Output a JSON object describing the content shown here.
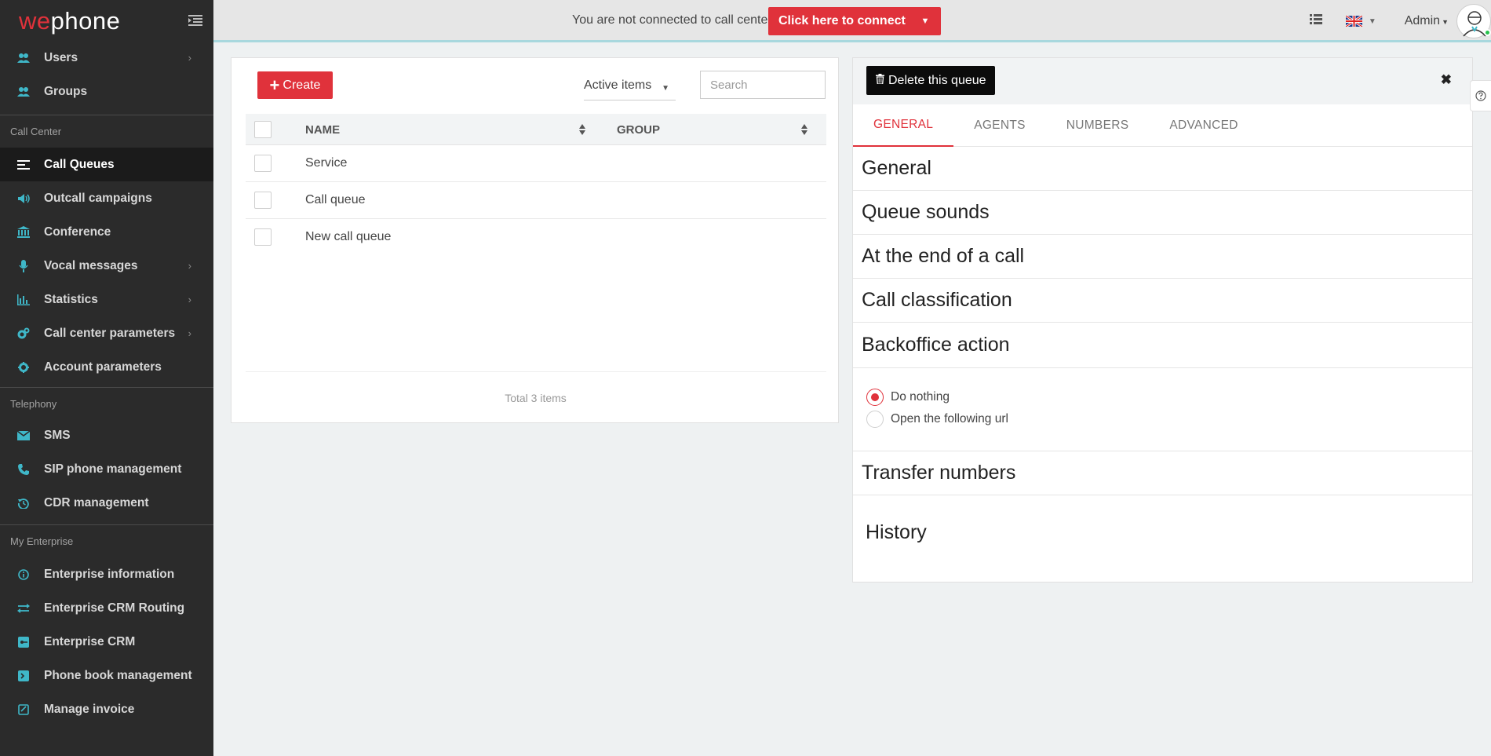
{
  "brand": {
    "logo_we": "we",
    "logo_phone": "phone"
  },
  "sidebar": {
    "items_top": [
      {
        "label": "Users",
        "icon": "users-icon",
        "chevron": true
      },
      {
        "label": "Groups",
        "icon": "groups-icon",
        "chevron": false
      }
    ],
    "section_call_center": "Call Center",
    "items_call_center": [
      {
        "label": "Call Queues",
        "icon": "queue-list-icon",
        "active": true
      },
      {
        "label": "Outcall campaigns",
        "icon": "megaphone-icon"
      },
      {
        "label": "Conference",
        "icon": "bank-icon"
      },
      {
        "label": "Vocal messages",
        "icon": "microphone-icon",
        "chevron": true
      },
      {
        "label": "Statistics",
        "icon": "bar-chart-icon",
        "chevron": true
      },
      {
        "label": "Call center parameters",
        "icon": "cogs-icon",
        "chevron": true
      },
      {
        "label": "Account parameters",
        "icon": "gear-icon"
      }
    ],
    "section_telephony": "Telephony",
    "items_telephony": [
      {
        "label": "SMS",
        "icon": "envelope-icon"
      },
      {
        "label": "SIP phone management",
        "icon": "phone-icon"
      },
      {
        "label": "CDR management",
        "icon": "history-icon"
      }
    ],
    "section_enterprise": "My Enterprise",
    "items_enterprise": [
      {
        "label": "Enterprise information",
        "icon": "info-icon"
      },
      {
        "label": "Enterprise CRM Routing",
        "icon": "exchange-icon"
      },
      {
        "label": "Enterprise CRM",
        "icon": "crm-icon"
      },
      {
        "label": "Phone book management",
        "icon": "phonebook-icon"
      },
      {
        "label": "Manage invoice",
        "icon": "invoice-icon"
      }
    ]
  },
  "topbar": {
    "status_text": "You are not connected to call center",
    "connect_label": "Click here to connect",
    "admin_label": "Admin"
  },
  "list": {
    "create_label": "Create",
    "filter_label": "Active items",
    "search_placeholder": "Search",
    "columns": {
      "name": "NAME",
      "group": "GROUP"
    },
    "rows": [
      {
        "name": "Service"
      },
      {
        "name": "Call queue"
      },
      {
        "name": "New call queue"
      }
    ],
    "total_label": "Total 3 items"
  },
  "detail": {
    "delete_label": "Delete this queue",
    "tabs": [
      "GENERAL",
      "AGENTS",
      "NUMBERS",
      "ADVANCED"
    ],
    "active_tab": "GENERAL",
    "sections": [
      "General",
      "Queue sounds",
      "At the end of a call",
      "Call classification",
      "Backoffice action"
    ],
    "backoffice_options": [
      "Do nothing",
      "Open the following url"
    ],
    "backoffice_selected": "Do nothing",
    "transfer_numbers": "Transfer numbers",
    "history": "History"
  },
  "colors": {
    "accent": "#e0323b",
    "sidebar_bg": "#2b2b2b",
    "icon_teal": "#3fb7c8"
  }
}
